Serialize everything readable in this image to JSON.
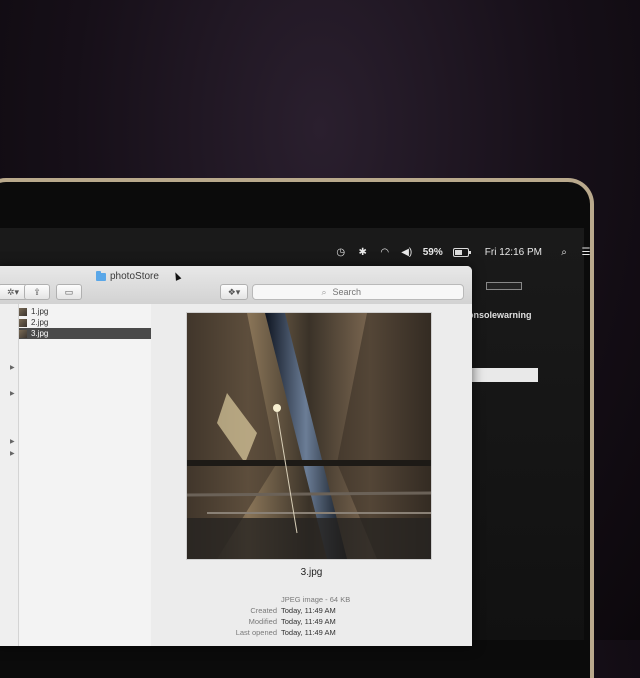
{
  "menubar": {
    "battery_pct": "59%",
    "datetime": "Fri 12:16 PM",
    "icons": [
      "timemachine-icon",
      "bluetooth-icon",
      "wifi-icon",
      "volume-icon",
      "battery-icon",
      "spotlight-icon",
      "notification-center-icon"
    ]
  },
  "background_app": {
    "title_fragment": "onsolewarning"
  },
  "finder": {
    "title": "photoStore",
    "search_placeholder": "Search",
    "files": [
      {
        "name": "1.jpg",
        "selected": false
      },
      {
        "name": "2.jpg",
        "selected": false
      },
      {
        "name": "3.jpg",
        "selected": true
      }
    ],
    "preview": {
      "filename": "3.jpg",
      "kind": "JPEG image - 64 KB",
      "rows": [
        {
          "key": "Created",
          "value": "Today, 11:49 AM"
        },
        {
          "key": "Modified",
          "value": "Today, 11:49 AM"
        },
        {
          "key": "Last opened",
          "value": "Today, 11:49 AM"
        }
      ]
    }
  }
}
